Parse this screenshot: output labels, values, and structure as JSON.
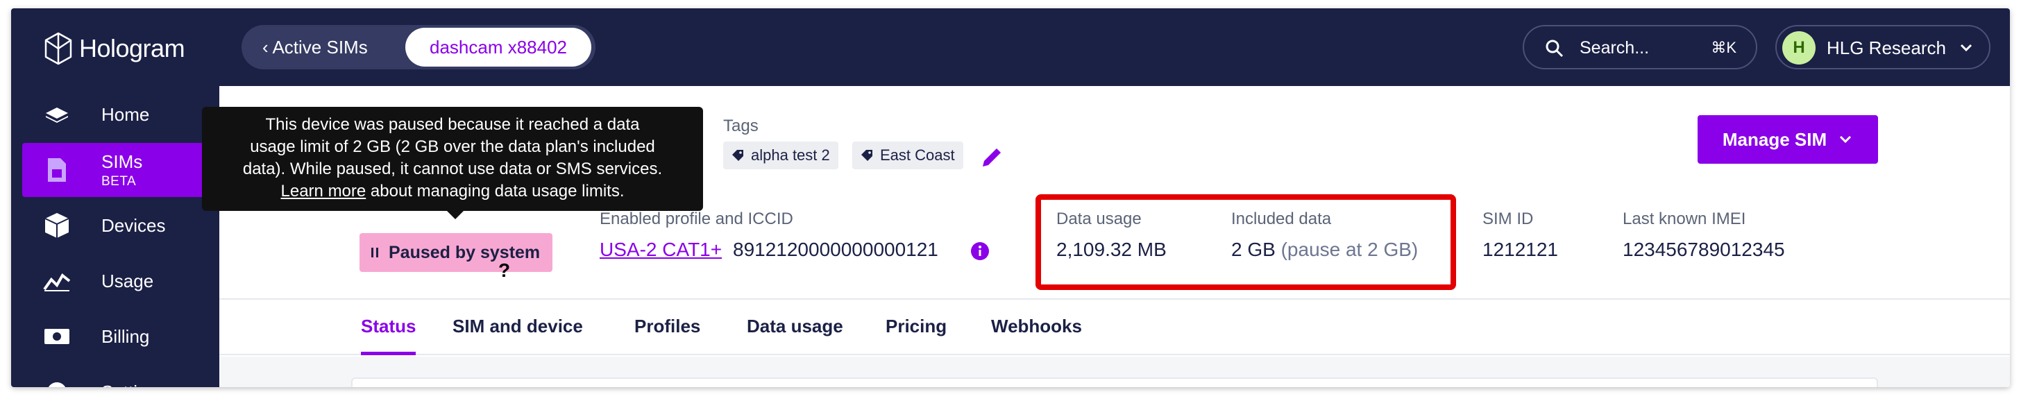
{
  "app": {
    "name": "Hologram"
  },
  "sidebar": {
    "items": [
      {
        "label": "Home",
        "icon": "home-icon"
      },
      {
        "label": "SIMs",
        "sublabel": "BETA",
        "icon": "sim-icon",
        "active": true
      },
      {
        "label": "Devices",
        "icon": "device-icon"
      },
      {
        "label": "Usage",
        "icon": "usage-icon"
      },
      {
        "label": "Billing",
        "icon": "billing-icon"
      },
      {
        "label": "Settings",
        "icon": "settings-icon"
      }
    ]
  },
  "header": {
    "breadcrumb_back": "Active SIMs",
    "breadcrumb_current": "dashcam x88402",
    "search_placeholder": "Search...",
    "search_shortcut": "⌘K",
    "org_initial": "H",
    "org_name": "HLG Research"
  },
  "details": {
    "tags_label": "Tags",
    "tags": [
      "alpha test 2",
      "East Coast"
    ],
    "manage_button": "Manage SIM",
    "profile_label": "Enabled profile and ICCID",
    "profile_link": "USA-2 CAT1+",
    "iccid": "8912120000000000121",
    "status_text": "Paused by system",
    "data_usage_label": "Data usage",
    "data_usage_value": "2,109.32 MB",
    "included_label": "Included data",
    "included_value": "2 GB",
    "included_note": "(pause at 2 GB)",
    "simid_label": "SIM ID",
    "simid_value": "1212121",
    "imei_label": "Last known IMEI",
    "imei_value": "123456789012345"
  },
  "tooltip": {
    "line1": "This device was paused because it reached a data",
    "line2": "usage limit of 2 GB (2 GB over the data plan's included",
    "line3": "data). While paused, it cannot use data or SMS services.",
    "link": "Learn more",
    "line4_rest": " about managing data usage limits."
  },
  "tabs": [
    "Status",
    "SIM and device",
    "Profiles",
    "Data usage",
    "Pricing",
    "Webhooks"
  ],
  "colors": {
    "brand": "#8a00e8",
    "nav_bg": "#1b2045",
    "highlight": "#e30000",
    "status_badge": "#f7a8d2"
  }
}
